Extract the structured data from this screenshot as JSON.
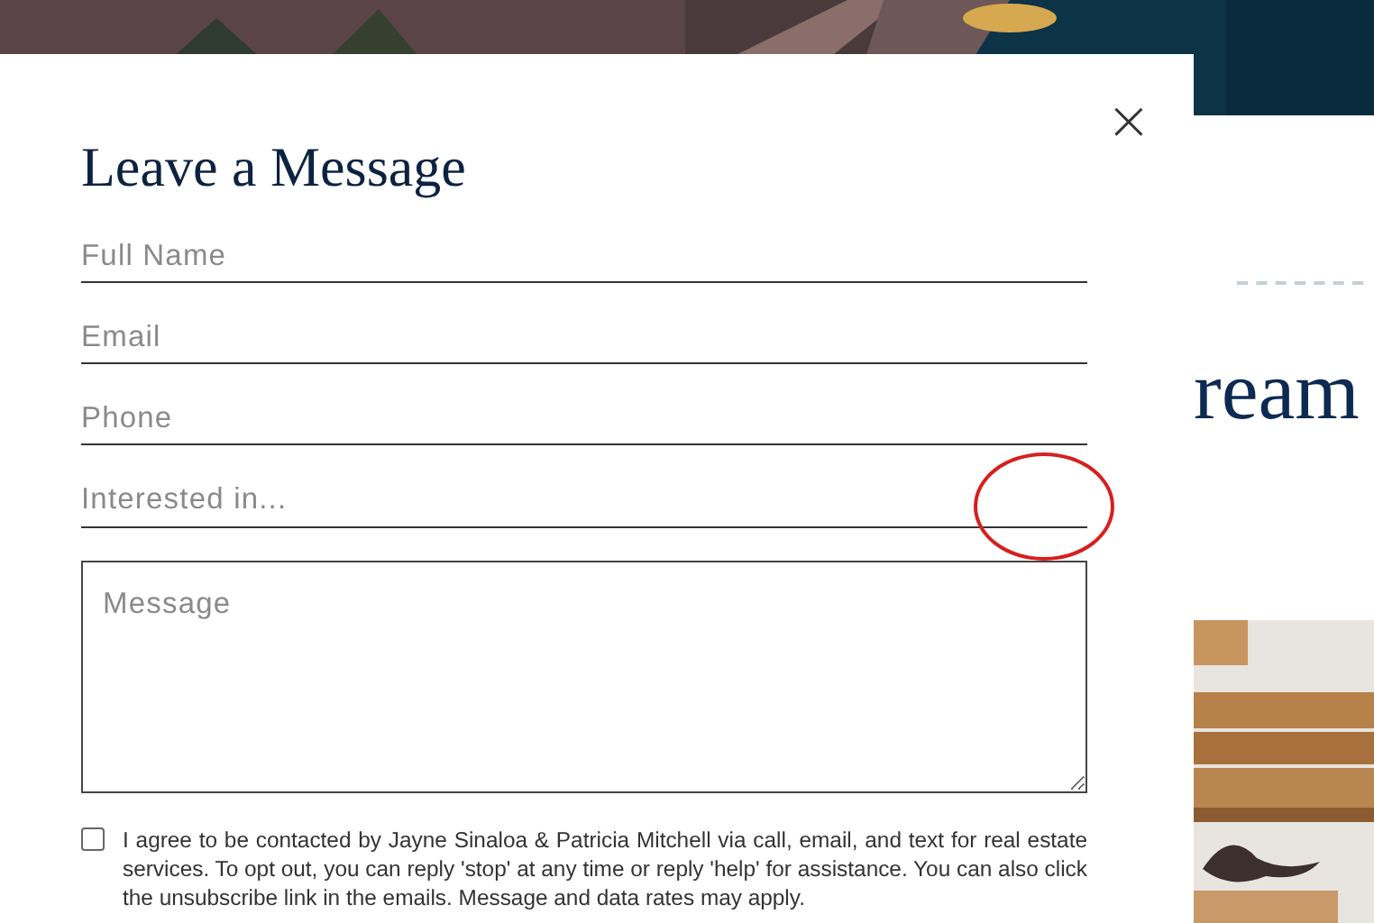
{
  "background": {
    "heading_fragment": "ream"
  },
  "dialog": {
    "title": "Leave a Message",
    "close": "×",
    "fields": [
      {
        "kind": "line",
        "placeholder": "Full Name"
      },
      {
        "kind": "line",
        "placeholder": "Email"
      },
      {
        "kind": "line",
        "placeholder": "Phone"
      },
      {
        "kind": "select",
        "placeholder": "Interested in..."
      },
      {
        "kind": "area",
        "placeholder": "Message"
      }
    ],
    "consent": {
      "checked": false,
      "text": "I agree to be contacted by Jayne Sinaloa & Patricia Mitchell via call, email, and text for real estate services. To opt out, you can reply 'stop' at any time or reply 'help' for assistance. You can also click the unsubscribe link in the emails. Message and data rates may apply."
    }
  }
}
